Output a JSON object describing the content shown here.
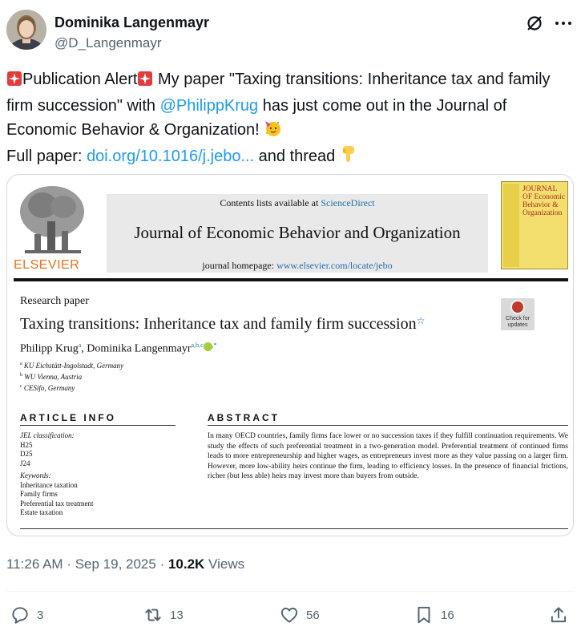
{
  "author": {
    "name": "Dominika Langenmayr",
    "handle": "@D_Langenmayr"
  },
  "tweet": {
    "alert_text": "Publication Alert",
    "text_a": " My paper \"Taxing transitions: Inheritance tax and family firm succession\" with ",
    "mention": "@PhilippKrug",
    "text_b": " has just come out in the Journal of Economic Behavior & Organization! ",
    "full_paper_label": "Full paper: ",
    "link": "doi.org/10.1016/j.jebo...",
    "text_c": " and thread ",
    "emoji_icons": [
      "rotating-light-icon",
      "rotating-light-icon",
      "party-face-icon",
      "pointing-down-icon"
    ]
  },
  "paper": {
    "publisher": "ELSEVIER",
    "contents_prefix": "Contents lists available at ",
    "contents_link": "ScienceDirect",
    "journal_title": "Journal of Economic Behavior and Organization",
    "homepage_prefix": "journal homepage: ",
    "homepage_url": "www.elsevier.com/locate/jebo",
    "cover_title": "JOURNAL OF Economic Behavior & Organization",
    "label": "Research paper",
    "title": "Taxing transitions: Inheritance tax and family firm succession",
    "title_marker": "☆",
    "check_updates": "Check for updates",
    "authors": {
      "a1": "Philipp Krug",
      "a1_sup": "a",
      "sep": ", ",
      "a2": "Dominika Langenmayr",
      "a2_sup": "a,b,c",
      "a2_star": ",*"
    },
    "affiliations": [
      {
        "sup": "a",
        "text": "KU Eichstätt-Ingolstadt, Germany"
      },
      {
        "sup": "b",
        "text": "WU Vienna, Austria"
      },
      {
        "sup": "c",
        "text": "CESifo, Germany"
      }
    ],
    "article_info_head": "ARTICLE INFO",
    "jel_label": "JEL classification:",
    "jel_codes": [
      "H25",
      "D25",
      "J24"
    ],
    "keywords_label": "Keywords:",
    "keywords": [
      "Inheritance taxation",
      "Family firms",
      "Preferential tax treatment",
      "Estate taxation"
    ],
    "abstract_head": "ABSTRACT",
    "abstract": "In many OECD countries, family firms face lower or no succession taxes if they fulfill continuation requirements. We study the effects of such preferential treatment in a two-generation model. Preferential treatment of continued firms leads to more entrepreneurship and higher wages, as entrepreneurs invest more as they value passing on a larger firm. However, more low-ability heirs continue the firm, leading to efficiency losses. In the presence of financial frictions, richer (but less able) heirs may invest more than buyers from outside."
  },
  "meta": {
    "time": "11:26 AM",
    "sep1": " · ",
    "date": "Sep 19, 2025",
    "sep2": " · ",
    "views_count": "10.2K",
    "views_label": " Views"
  },
  "actions": {
    "replies": "3",
    "reposts": "13",
    "likes": "56",
    "bookmarks": "16"
  }
}
